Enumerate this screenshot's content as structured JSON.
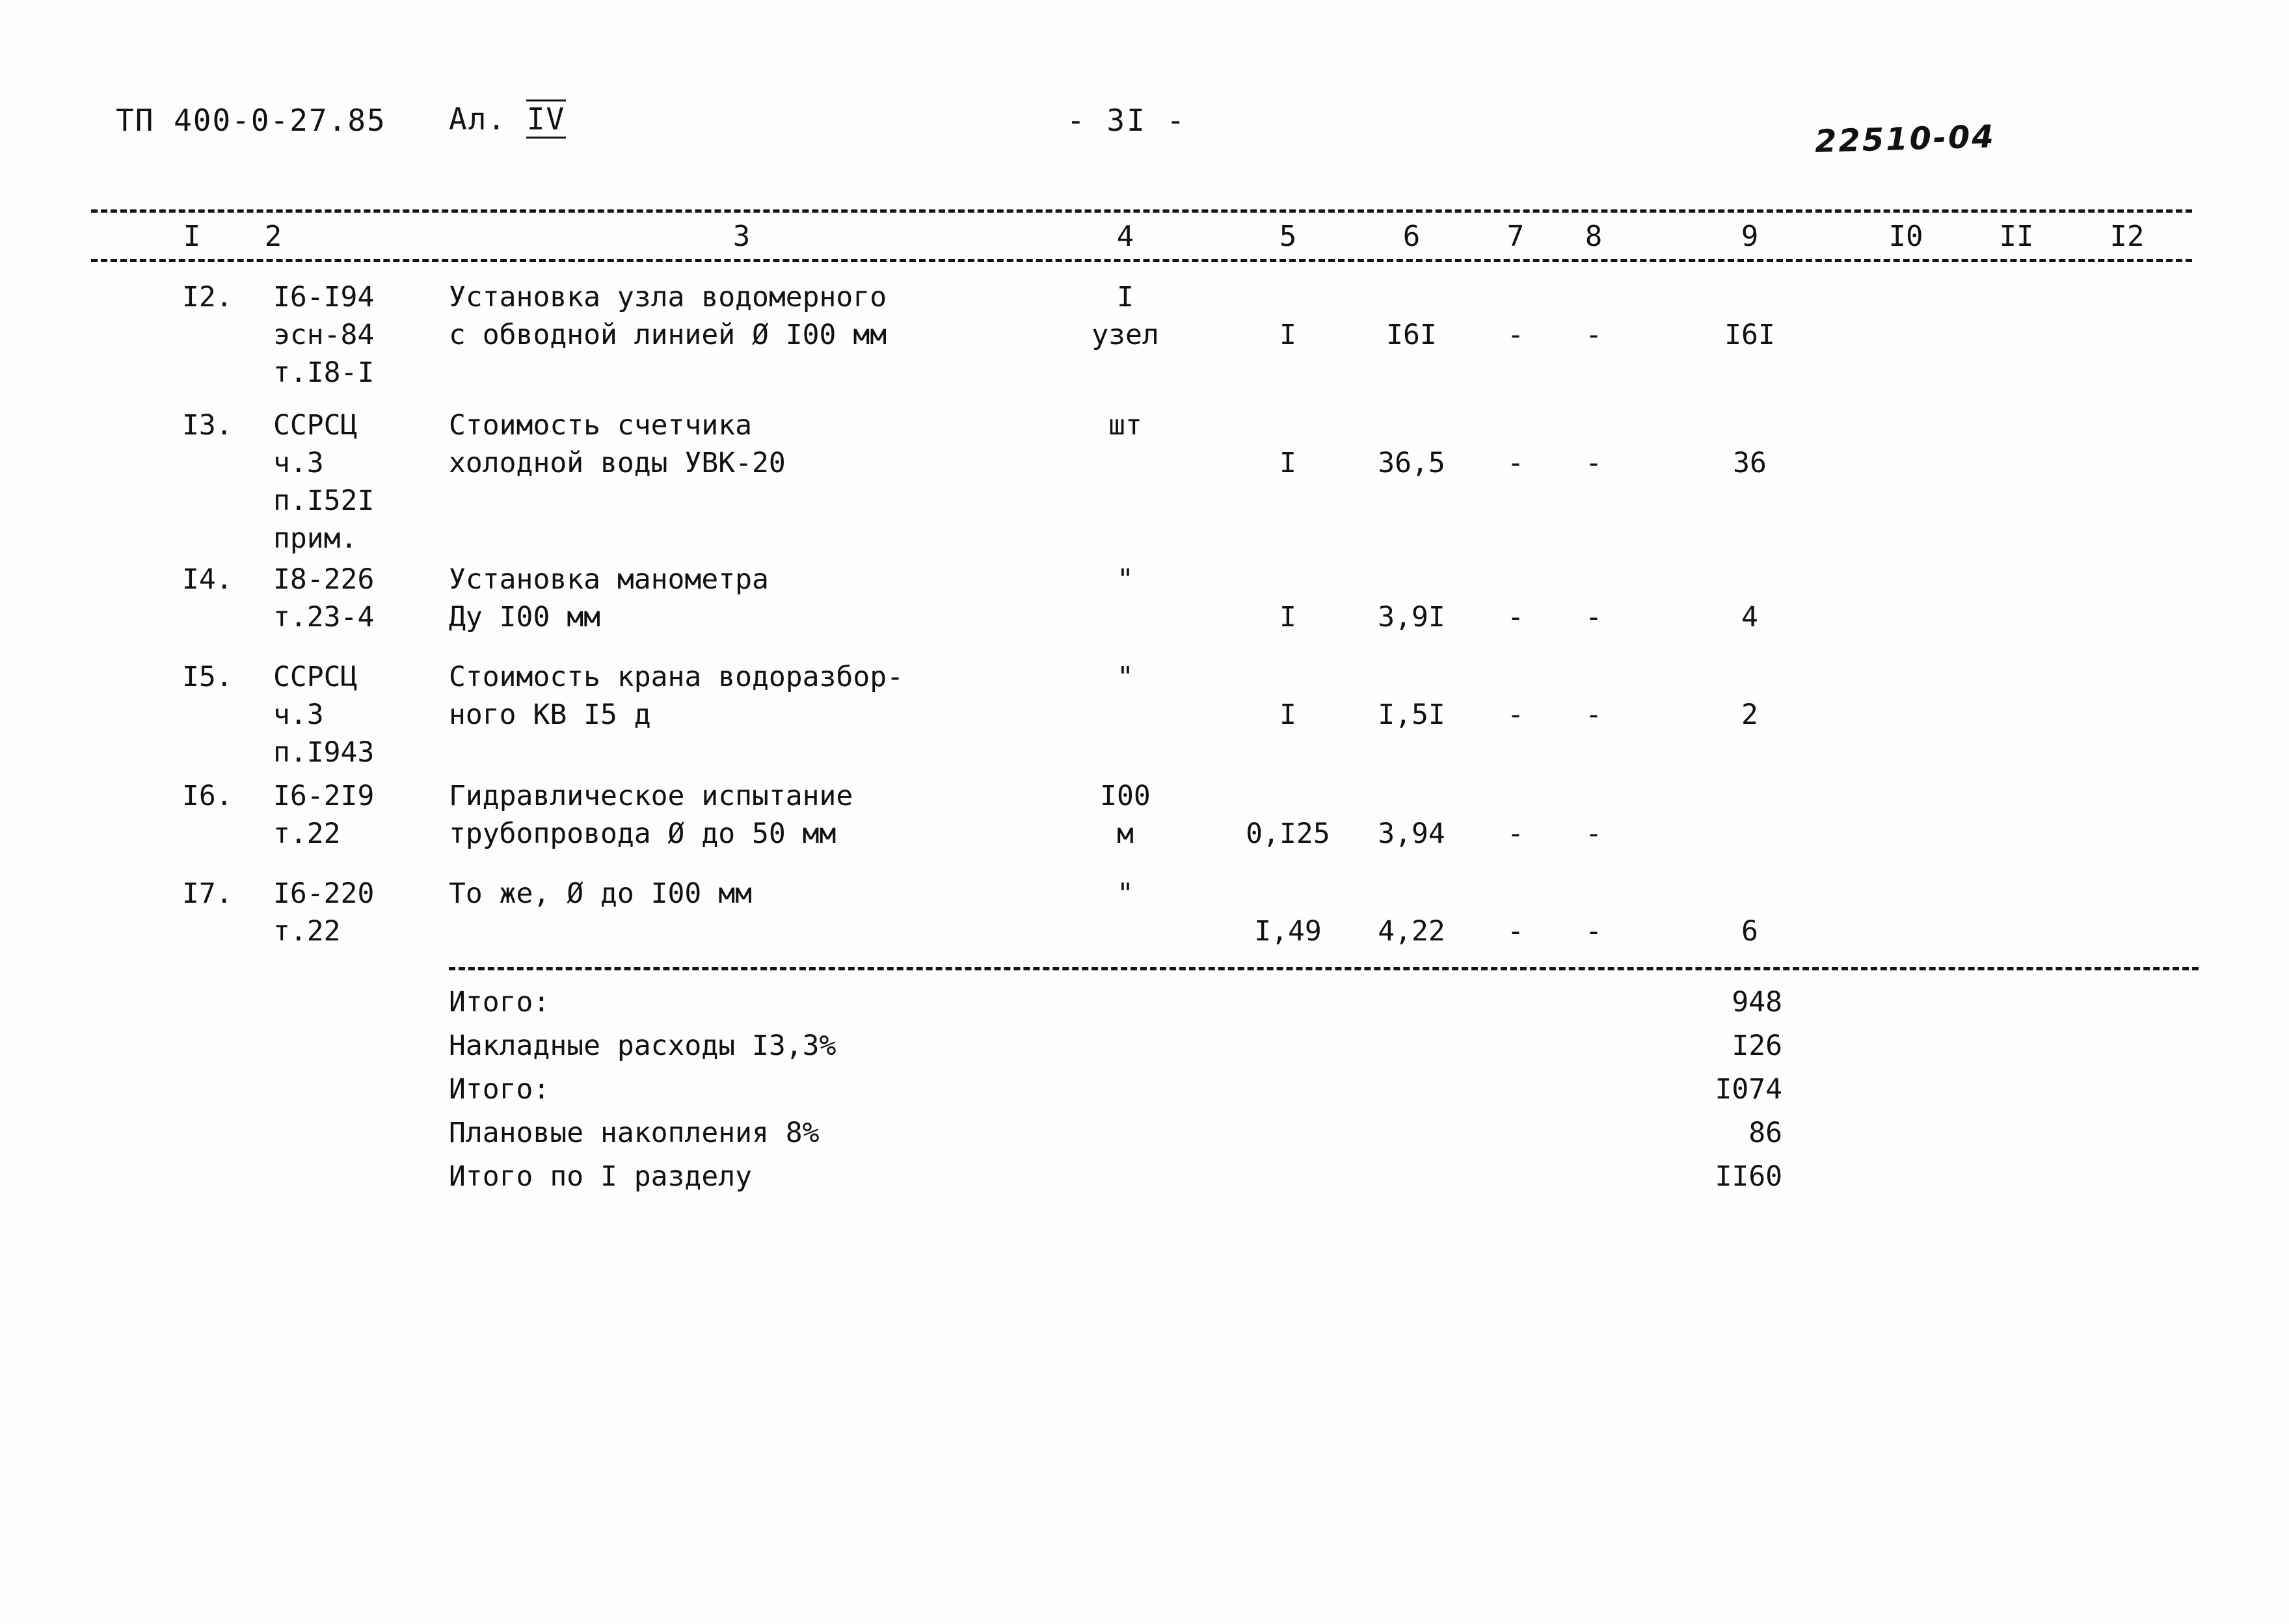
{
  "header": {
    "doc_code": "ТП 400-0-27.85",
    "album_label": "Ал.",
    "album_number": "IV",
    "page_number": "- 3I -",
    "archive_stamp": "22510-04"
  },
  "table": {
    "column_headers": [
      "I",
      "2",
      "3",
      "4",
      "5",
      "6",
      "7",
      "8",
      "9",
      "I0",
      "II",
      "I2"
    ],
    "rows": [
      {
        "no": "I2.",
        "code_lines": [
          "I6-I94",
          "эсн-84",
          "т.I8-I"
        ],
        "name_lines": [
          "Установка узла водомерного",
          "с обводной линией Ø I00 мм"
        ],
        "unit_lines": [
          "I",
          "узел"
        ],
        "qty": "I",
        "price": "I6I",
        "col7": "-",
        "col8": "-",
        "total": "I6I",
        "col10": "",
        "col11": "",
        "col12": ""
      },
      {
        "no": "I3.",
        "code_lines": [
          "ССРСЦ",
          "ч.3",
          "п.I52I",
          "прим."
        ],
        "name_lines": [
          "Стоимость счетчика",
          "холодной воды УВК-20"
        ],
        "unit_lines": [
          "шт"
        ],
        "qty": "I",
        "price": "36,5",
        "col7": "-",
        "col8": "-",
        "total": "36",
        "col10": "",
        "col11": "",
        "col12": ""
      },
      {
        "no": "I4.",
        "code_lines": [
          "I8-226",
          "т.23-4"
        ],
        "name_lines": [
          "Установка манометра",
          "Ду I00 мм"
        ],
        "unit_lines": [
          "\""
        ],
        "qty": "I",
        "price": "3,9I",
        "col7": "-",
        "col8": "-",
        "total": "4",
        "col10": "",
        "col11": "",
        "col12": ""
      },
      {
        "no": "I5.",
        "code_lines": [
          "ССРСЦ",
          "ч.3",
          "п.I943"
        ],
        "name_lines": [
          "Стоимость крана водоразбор-",
          "ного КВ I5 д"
        ],
        "unit_lines": [
          "\""
        ],
        "qty": "I",
        "price": "I,5I",
        "col7": "-",
        "col8": "-",
        "total": "2",
        "col10": "",
        "col11": "",
        "col12": ""
      },
      {
        "no": "I6.",
        "code_lines": [
          "I6-2I9",
          "т.22"
        ],
        "name_lines": [
          "Гидравлическое испытание",
          "трубопровода Ø до 50 мм"
        ],
        "unit_lines": [
          "I00",
          "м"
        ],
        "qty": "0,I25",
        "price": "3,94",
        "col7": "-",
        "col8": "-",
        "total": "",
        "col10": "",
        "col11": "",
        "col12": ""
      },
      {
        "no": "I7.",
        "code_lines": [
          "I6-220",
          "т.22"
        ],
        "name_lines": [
          "То же, Ø до I00 мм"
        ],
        "unit_lines": [
          "\""
        ],
        "qty": "I,49",
        "price": "4,22",
        "col7": "-",
        "col8": "-",
        "total": "6",
        "col10": "",
        "col11": "",
        "col12": ""
      }
    ]
  },
  "totals": [
    {
      "label": "Итого:",
      "value": "948"
    },
    {
      "label": "Накладные расходы I3,3%",
      "value": "I26"
    },
    {
      "label": "Итого:",
      "value": "I074"
    },
    {
      "label": "Плановые накопления 8%",
      "value": "86"
    },
    {
      "label": "Итого по I разделу",
      "value": "II60"
    }
  ]
}
